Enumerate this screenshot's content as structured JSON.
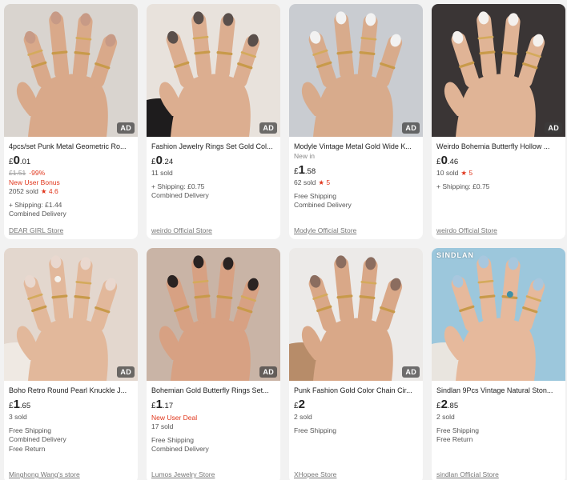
{
  "colors": {
    "accent_red": "#e0361c",
    "text_gray": "#555555"
  },
  "products": [
    {
      "title": "4pcs/set Punk Metal Geometric Ro...",
      "ad_label": "AD",
      "price_currency": "£",
      "price_int": "0",
      "price_dec": ".01",
      "original_price": "£1.51",
      "discount": "-99%",
      "promo": "New User Bonus",
      "sold": "2052 sold",
      "rating": "★ 4.6",
      "shipping": "+ Shipping: £1.44",
      "delivery": "Combined Delivery",
      "store": "DEAR GIRL Store",
      "image_icon": "rings-on-hand-photo"
    },
    {
      "title": "Fashion Jewelry Rings Set Gold Col...",
      "ad_label": "AD",
      "price_currency": "£",
      "price_int": "0",
      "price_dec": ".24",
      "sold": "11 sold",
      "shipping": "+ Shipping: £0.75",
      "delivery": "Combined Delivery",
      "store": "weirdo Official Store",
      "image_icon": "rings-on-hand-photo"
    },
    {
      "title": "Modyle Vintage Metal Gold Wide K...",
      "ad_label": "AD",
      "new_in": "New in",
      "price_currency": "£",
      "price_int": "1",
      "price_dec": ".58",
      "sold": "62 sold",
      "rating": "★ 5",
      "shipping": "Free Shipping",
      "delivery": "Combined Delivery",
      "store": "Modyle Official Store",
      "image_icon": "rings-on-hand-photo"
    },
    {
      "title": "Weirdo Bohemia Butterfly Hollow ...",
      "ad_label": "AD",
      "price_currency": "£",
      "price_int": "0",
      "price_dec": ".46",
      "sold": "10 sold",
      "rating": "★ 5",
      "shipping": "+ Shipping: £0.75",
      "store": "weirdo Official Store",
      "image_icon": "rings-on-hand-photo"
    },
    {
      "title": "Boho Retro Round Pearl Knuckle J...",
      "ad_label": "AD",
      "price_currency": "£",
      "price_int": "1",
      "price_dec": ".65",
      "sold": "3 sold",
      "shipping": "Free Shipping",
      "delivery": "Combined Delivery",
      "return": "Free Return",
      "store": "Minghong Wang's store",
      "image_icon": "rings-on-hand-photo"
    },
    {
      "title": "Bohemian Gold Butterfly Rings Set...",
      "ad_label": "AD",
      "price_currency": "£",
      "price_int": "1",
      "price_dec": ".17",
      "promo": "New User Deal",
      "sold": "17 sold",
      "shipping": "Free Shipping",
      "delivery": "Combined Delivery",
      "store": "Lumos Jewelry Store",
      "image_icon": "rings-on-hand-photo"
    },
    {
      "title": "Punk Fashion Gold Color Chain Cir...",
      "ad_label": "AD",
      "price_currency": "£",
      "price_int": "2",
      "price_dec": "",
      "sold": "2 sold",
      "shipping": "Free Shipping",
      "store": "XHopee Store",
      "image_icon": "rings-on-hand-photo"
    },
    {
      "title": "Sindlan 9Pcs Vintage Natural Ston...",
      "brand_tag": "SINDLAN",
      "price_currency": "£",
      "price_int": "2",
      "price_dec": ".85",
      "sold": "2 sold",
      "shipping": "Free Shipping",
      "return": "Free Return",
      "store": "sindlan Official Store",
      "image_icon": "rings-on-hand-photo"
    }
  ]
}
